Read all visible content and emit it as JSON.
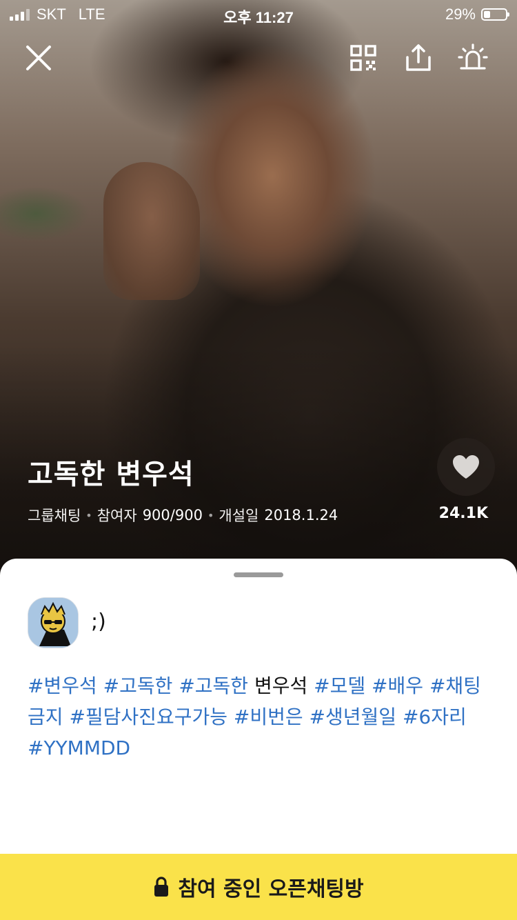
{
  "status_bar": {
    "carrier": "SKT",
    "network": "LTE",
    "time": "오후 11:27",
    "battery": "29%",
    "battery_level": 0.29
  },
  "toolbar": {
    "icons": [
      "close-icon",
      "qr-code-icon",
      "share-icon",
      "report-siren-icon"
    ]
  },
  "room": {
    "title": "고독한 변우석",
    "type": "그룹채팅",
    "participants_label": "참여자",
    "participants_value": "900/900",
    "opened_label": "개설일",
    "opened_value": "2018.1.24",
    "likes": "24.1K"
  },
  "profile": {
    "description": ";)"
  },
  "tags": [
    {
      "text": "#변우석",
      "type": "tag"
    },
    {
      "text": " ",
      "type": "plain"
    },
    {
      "text": "#고독한",
      "type": "tag"
    },
    {
      "text": " ",
      "type": "plain"
    },
    {
      "text": "#고독한",
      "type": "tag"
    },
    {
      "text": " 변우석 ",
      "type": "plain"
    },
    {
      "text": "#모델",
      "type": "tag"
    },
    {
      "text": " ",
      "type": "plain"
    },
    {
      "text": "#배우",
      "type": "tag"
    },
    {
      "text": " ",
      "type": "plain"
    },
    {
      "text": "#채팅금지",
      "type": "tag"
    },
    {
      "text": " ",
      "type": "plain"
    },
    {
      "text": "#필담사진요구가능",
      "type": "tag"
    },
    {
      "text": " ",
      "type": "plain"
    },
    {
      "text": "#비번은",
      "type": "tag"
    },
    {
      "text": " ",
      "type": "plain"
    },
    {
      "text": "#생년월일",
      "type": "tag"
    },
    {
      "text": " ",
      "type": "plain"
    },
    {
      "text": "#6자리",
      "type": "tag"
    },
    {
      "text": " ",
      "type": "plain"
    },
    {
      "text": "#YYMMDD",
      "type": "tag"
    }
  ],
  "join_button": {
    "label": "참여 중인 오픈채팅방",
    "icon": "lock-icon"
  },
  "colors": {
    "join_bar": "#fae24a",
    "tag": "#2f71c4"
  }
}
